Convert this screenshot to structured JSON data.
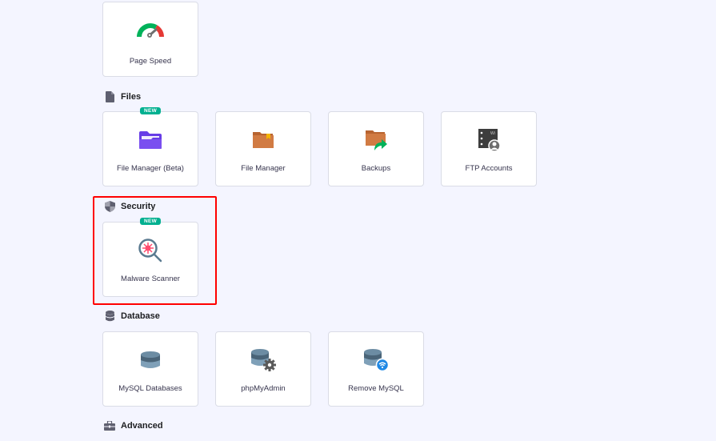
{
  "sections": {
    "files": {
      "title": "Files",
      "icon": "file-icon"
    },
    "security": {
      "title": "Security",
      "icon": "shield-icon"
    },
    "database": {
      "title": "Database",
      "icon": "database-icon"
    },
    "advanced": {
      "title": "Advanced",
      "icon": "briefcase-icon"
    }
  },
  "cards": {
    "page_speed": {
      "label": "Page Speed",
      "icon": "speedometer-icon"
    },
    "file_manager_beta": {
      "label": "File Manager (Beta)",
      "icon": "folder-icon",
      "badge": "NEW"
    },
    "file_manager": {
      "label": "File Manager",
      "icon": "folder-bookmark-icon"
    },
    "backups": {
      "label": "Backups",
      "icon": "folder-share-icon"
    },
    "ftp_accounts": {
      "label": "FTP Accounts",
      "icon": "ftp-user-icon"
    },
    "malware_scanner": {
      "label": "Malware Scanner",
      "icon": "virus-search-icon",
      "badge": "NEW"
    },
    "mysql_databases": {
      "label": "MySQL Databases",
      "icon": "database-icon"
    },
    "phpmyadmin": {
      "label": "phpMyAdmin",
      "icon": "database-gear-icon"
    },
    "remote_mysql": {
      "label": "Remove MySQL",
      "icon": "database-wifi-icon"
    }
  },
  "colors": {
    "background": "#f4f5ff",
    "badge": "#00b090",
    "highlight": "#ff0000",
    "folder_purple": "#673de6",
    "folder_orange": "#d17b43",
    "arrow_green": "#00b25a",
    "db_blue": "#5a7a90",
    "wifi_blue": "#1e88e5"
  }
}
